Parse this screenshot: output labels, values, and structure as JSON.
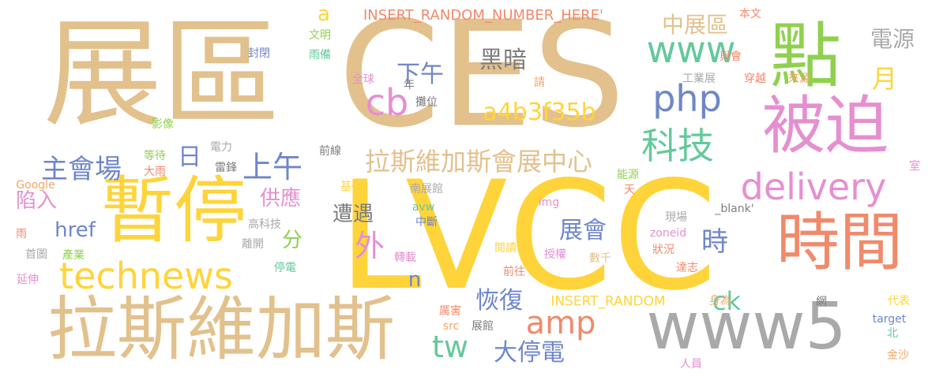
{
  "colors": {
    "tan": "#E2C18D",
    "yellow": "#FFD43B",
    "green": "#8FD14F",
    "pink": "#E58FD0",
    "salmon": "#F08A6B",
    "blue": "#6F86C9",
    "gray": "#A9A9A9",
    "teal": "#63C99A",
    "darkgray": "#7D7D7D",
    "orange": "#F4A460"
  },
  "words": [
    {
      "text": "展區"
    },
    {
      "text": "CES"
    },
    {
      "text": "LVCC"
    },
    {
      "text": "暫停"
    },
    {
      "text": "拉斯維加斯"
    },
    {
      "text": "點"
    },
    {
      "text": "被迫"
    },
    {
      "text": "時間"
    },
    {
      "text": "www5"
    },
    {
      "text": "www"
    },
    {
      "text": "php"
    },
    {
      "text": "cb"
    },
    {
      "text": "科技"
    },
    {
      "text": "delivery"
    },
    {
      "text": "technews"
    },
    {
      "text": "主會場"
    },
    {
      "text": "上午"
    },
    {
      "text": "日"
    },
    {
      "text": "拉斯維加斯會展中心"
    },
    {
      "text": "a4b3f35b"
    },
    {
      "text": "中展區"
    },
    {
      "text": "電源"
    },
    {
      "text": "月"
    },
    {
      "text": "黑暗"
    },
    {
      "text": "下午"
    },
    {
      "text": "amp"
    },
    {
      "text": "外"
    },
    {
      "text": "展會"
    },
    {
      "text": "時"
    },
    {
      "text": "恢復"
    },
    {
      "text": "tw"
    },
    {
      "text": "大停電"
    },
    {
      "text": "ck"
    },
    {
      "text": "遭遇"
    },
    {
      "text": "供應"
    },
    {
      "text": "陷入"
    },
    {
      "text": "href"
    },
    {
      "text": "分"
    },
    {
      "text": "n"
    },
    {
      "text": "a"
    },
    {
      "text": "INSERT_RANDOM_NUMBER_HERE'"
    },
    {
      "text": "INSERT_RANDOM"
    },
    {
      "text": "本文"
    },
    {
      "text": "文明"
    },
    {
      "text": "封閉"
    },
    {
      "text": "雨備"
    },
    {
      "text": "與會"
    },
    {
      "text": "全球"
    },
    {
      "text": "年"
    },
    {
      "text": "請"
    },
    {
      "text": "工業展"
    },
    {
      "text": "穿越"
    },
    {
      "text": "來源"
    },
    {
      "text": "攤位"
    },
    {
      "text": "影像"
    },
    {
      "text": "電力"
    },
    {
      "text": "前線"
    },
    {
      "text": "等待"
    },
    {
      "text": "大雨"
    },
    {
      "text": "雷鋒"
    },
    {
      "text": "能源"
    },
    {
      "text": "室"
    },
    {
      "text": "Google"
    },
    {
      "text": "基礎"
    },
    {
      "text": "南展館"
    },
    {
      "text": "天"
    },
    {
      "text": "avw"
    },
    {
      "text": "中斷"
    },
    {
      "text": "img"
    },
    {
      "text": "_blank'"
    },
    {
      "text": "高科技"
    },
    {
      "text": "現場"
    },
    {
      "text": "雨"
    },
    {
      "text": "產業"
    },
    {
      "text": "首圖"
    },
    {
      "text": "離開"
    },
    {
      "text": "zoneid"
    },
    {
      "text": "狀況"
    },
    {
      "text": "閱讀"
    },
    {
      "text": "授權"
    },
    {
      "text": "數千"
    },
    {
      "text": "延伸"
    },
    {
      "text": "停電"
    },
    {
      "text": "轉載"
    },
    {
      "text": "前往"
    },
    {
      "text": "達志"
    },
    {
      "text": "厲害"
    },
    {
      "text": "src"
    },
    {
      "text": "展館"
    },
    {
      "text": "身為"
    },
    {
      "text": "網"
    },
    {
      "text": "代表"
    },
    {
      "text": "target"
    },
    {
      "text": "北"
    },
    {
      "text": "人員"
    },
    {
      "text": "金沙"
    }
  ]
}
